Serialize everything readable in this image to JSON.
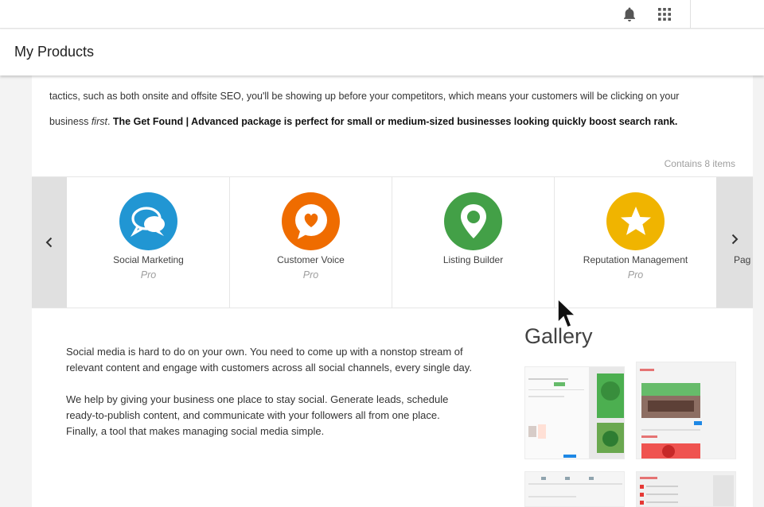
{
  "header": {
    "bell_icon": "bell-icon",
    "apps_icon": "grid-apps-icon"
  },
  "page": {
    "title": "My Products"
  },
  "package": {
    "intro_line1": "tactics, such as both onsite and offsite SEO, you'll be showing up before your competitors, which means your customers will be clicking on your",
    "intro_line2_prefix": "business ",
    "intro_line2_emph": "first",
    "intro_line2_sep": ". ",
    "intro_line2_bold": "The Get Found | Advanced package is perfect for small or medium-sized businesses looking quickly boost search rank.",
    "contains": "Contains 8 items"
  },
  "carousel": {
    "prev_icon": "chevron-left-icon",
    "next_icon": "chevron-right-icon",
    "items": [
      {
        "name": "Social Marketing",
        "tier": "Pro",
        "icon": "speech-bubbles-icon",
        "color": "#2196d3"
      },
      {
        "name": "Customer Voice",
        "tier": "Pro",
        "icon": "heart-bubble-icon",
        "color": "#ef6c00"
      },
      {
        "name": "Listing Builder",
        "tier": "",
        "icon": "map-pin-icon",
        "color": "#43a047"
      },
      {
        "name": "Reputation Management",
        "tier": "Pro",
        "icon": "star-icon",
        "color": "#f0b400"
      }
    ],
    "peek_label": "Pag"
  },
  "description": {
    "p1": "Social media is hard to do on your own. You need to come up with a nonstop stream of relevant content and engage with customers across all social channels, every single day.",
    "p2": "We help by giving your business one place to stay social. Generate leads, schedule ready-to-publish content, and communicate with your followers all from one place. Finally, a tool that makes managing social media simple."
  },
  "gallery": {
    "title": "Gallery"
  }
}
